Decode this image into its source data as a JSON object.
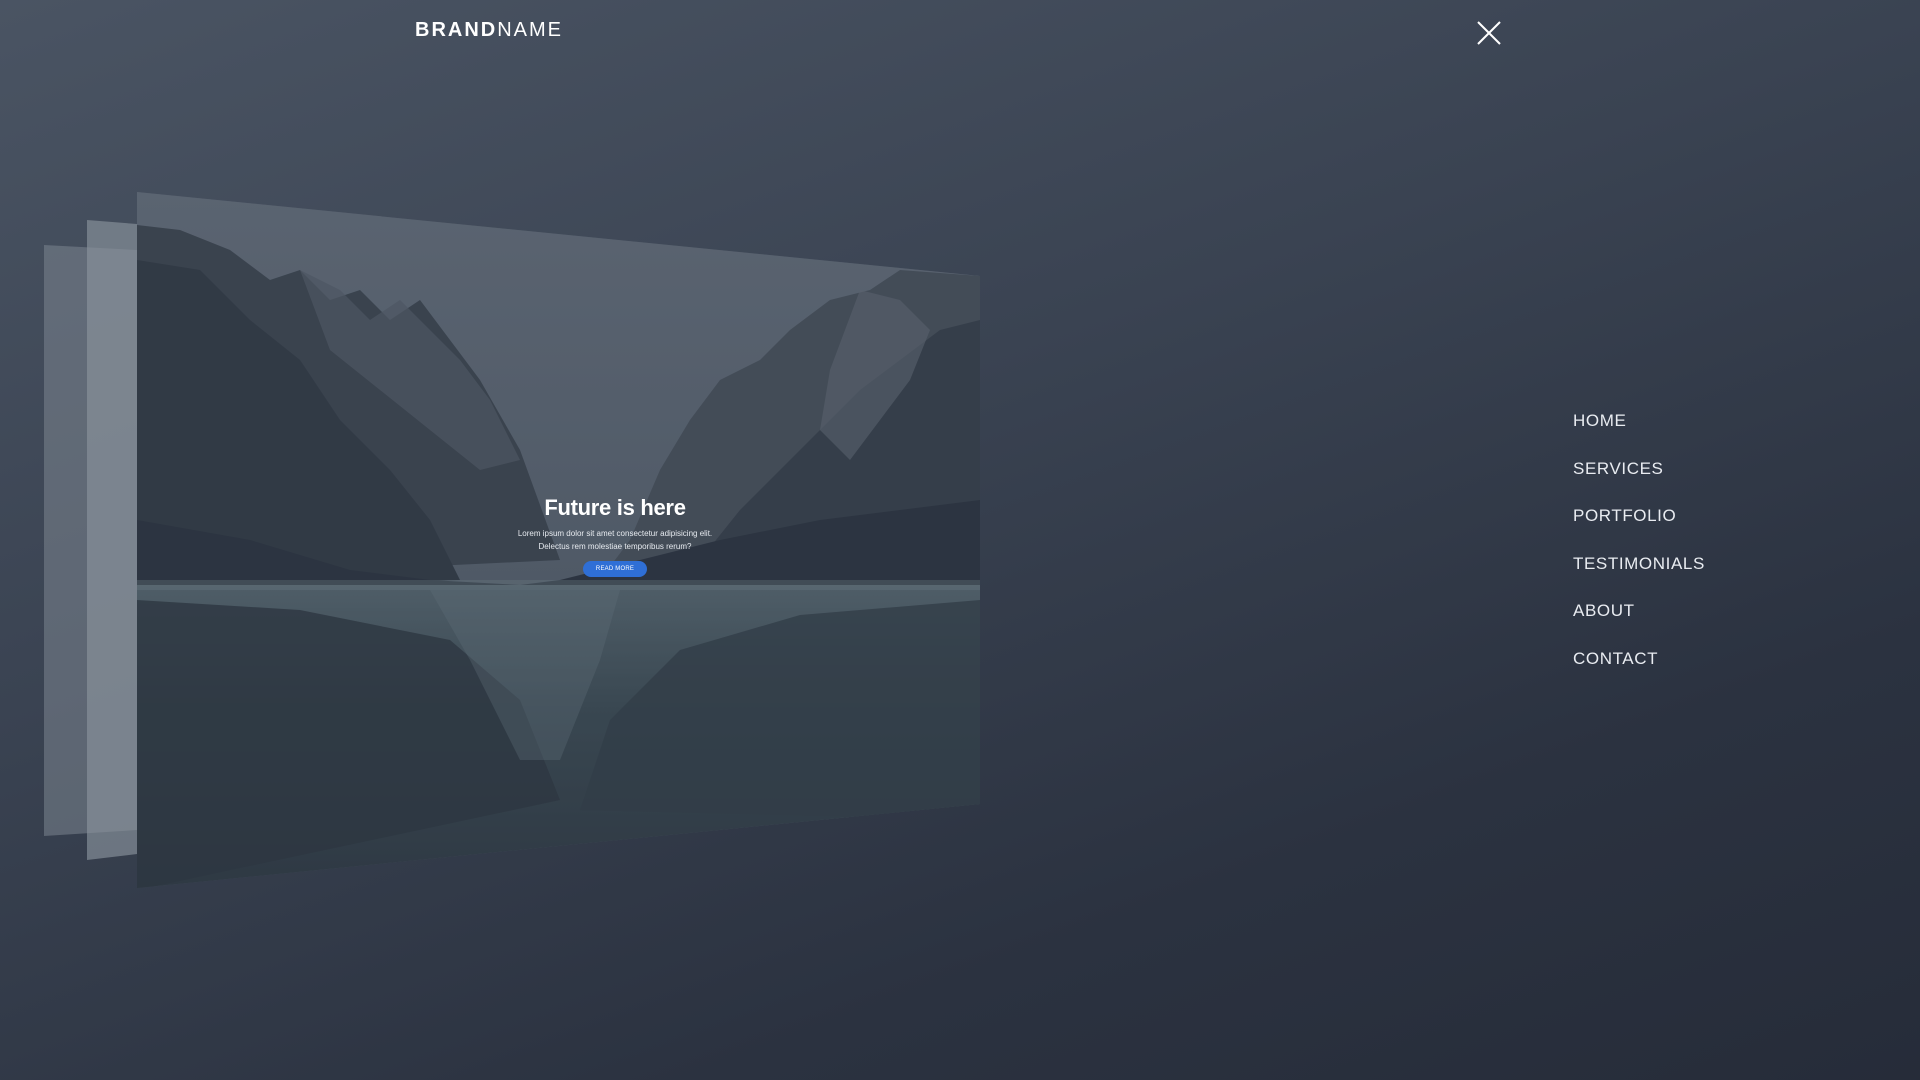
{
  "header": {
    "brand_bold": "BRAND",
    "brand_light": "NAME",
    "close_icon": "close-icon"
  },
  "hero": {
    "title": "Future is here",
    "subtitle_line1": "Lorem ipsum dolor sit amet consectetur adipisicing elit.",
    "subtitle_line2": "Delectus rem molestiae temporibus rerum?",
    "button_label": "READ MORE"
  },
  "menu": {
    "items": [
      {
        "label": "HOME"
      },
      {
        "label": "SERVICES"
      },
      {
        "label": "PORTFOLIO"
      },
      {
        "label": "TESTIMONIALS"
      },
      {
        "label": "ABOUT"
      },
      {
        "label": "CONTACT"
      }
    ]
  },
  "colors": {
    "accent": "#2f6fd6",
    "background": "#343c4a"
  }
}
